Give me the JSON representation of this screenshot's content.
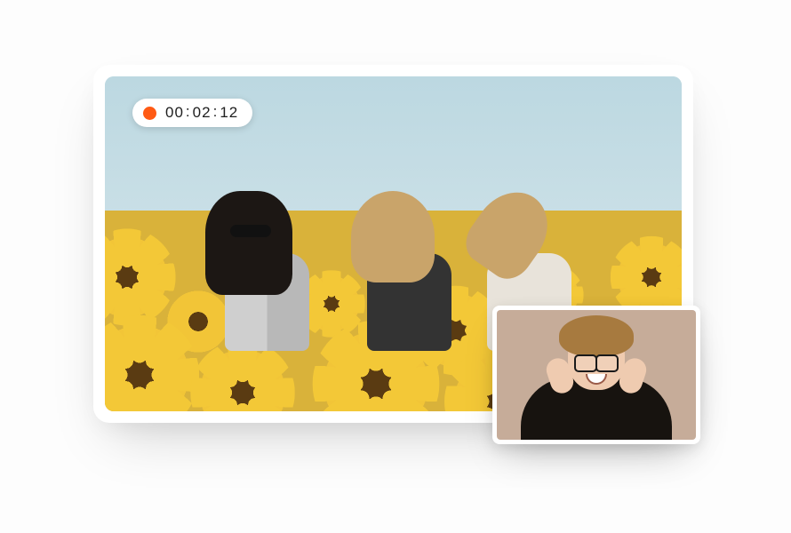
{
  "recording": {
    "indicator_color": "#ff5a14",
    "time_hh": "00",
    "time_mm": "02",
    "time_ss": "12"
  },
  "main_view": {
    "description": "Three young women laughing in a sunflower field under a pale sky",
    "persons": 3
  },
  "webcam_pip": {
    "description": "Smiling person with short hair and glasses, hands on cheeks, warm beige background"
  }
}
